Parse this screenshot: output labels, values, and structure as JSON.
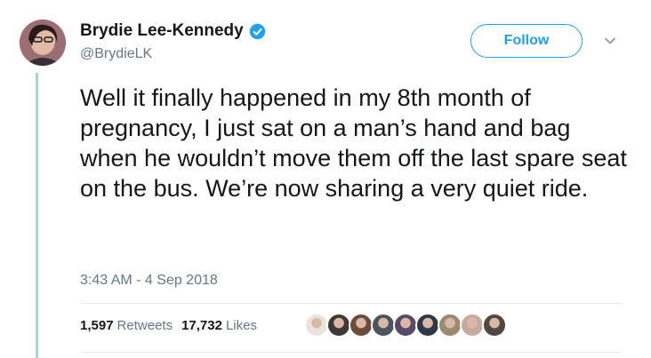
{
  "author": {
    "name": "Brydie Lee-Kennedy",
    "handle": "@BrydieLK",
    "verified": true,
    "avatar_icon": "profile-photo"
  },
  "follow_button": {
    "label": "Follow"
  },
  "menu_icon": "chevron-down-icon",
  "tweet": {
    "text": "Well it finally happened in my 8th month of pregnancy, I just sat on a man’s hand and bag when he wouldn’t move them off the last spare seat on the bus. We’re now sharing a very quiet ride.",
    "timestamp": "3:43 AM - 4 Sep 2018"
  },
  "stats": {
    "retweets_count": "1,597",
    "retweets_label": "Retweets",
    "likes_count": "17,732",
    "likes_label": "Likes"
  },
  "likers": [
    {
      "name": "liker-1",
      "color": "#e8e4dc"
    },
    {
      "name": "liker-2",
      "color": "#3d3a36"
    },
    {
      "name": "liker-3",
      "color": "#6b4d3a"
    },
    {
      "name": "liker-4",
      "color": "#4a5560"
    },
    {
      "name": "liker-5",
      "color": "#5a4a6a"
    },
    {
      "name": "liker-6",
      "color": "#2e3846"
    },
    {
      "name": "liker-7",
      "color": "#9a8a70"
    },
    {
      "name": "liker-8",
      "color": "#c7a9a0"
    },
    {
      "name": "liker-9",
      "color": "#4f4840"
    }
  ],
  "colors": {
    "accent": "#1da1f2",
    "thread_line": "#a4d0f0",
    "text_primary": "#14171a",
    "text_secondary": "#657786"
  }
}
